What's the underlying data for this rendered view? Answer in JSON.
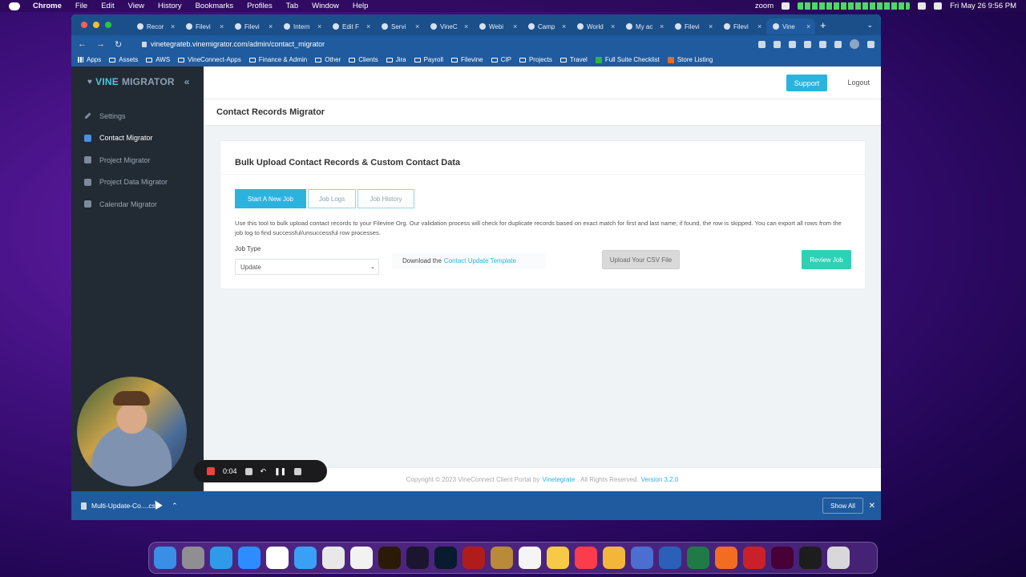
{
  "menubar": {
    "app": "Chrome",
    "items": [
      "File",
      "Edit",
      "View",
      "History",
      "Bookmarks",
      "Profiles",
      "Tab",
      "Window",
      "Help"
    ],
    "zoom": "zoom",
    "clock": "Fri May 26  9:56 PM"
  },
  "browser": {
    "tabs": [
      "Recor",
      "Filevi",
      "Filevi",
      "Intern",
      "Edit F",
      "Servi",
      "VineC",
      "Webi",
      "Camp",
      "World",
      "My ac",
      "Filevi",
      "Filevi",
      "Vine"
    ],
    "url": "vinetegrateb.vinemigrator.com/admin/contact_migrator",
    "bookmarks": [
      "Apps",
      "Assets",
      "AWS",
      "VineConnect-Apps",
      "Finance & Admin",
      "Other",
      "Clients",
      "Jira",
      "Payroll",
      "Filevine",
      "CIP",
      "Projects",
      "Travel",
      "Full Suite Checklist",
      "Store Listing"
    ]
  },
  "sidebar": {
    "logo_vine": "VINE",
    "logo_migrator": "MIGRATOR",
    "items": [
      {
        "label": "Settings"
      },
      {
        "label": "Contact Migrator"
      },
      {
        "label": "Project Migrator"
      },
      {
        "label": "Project Data Migrator"
      },
      {
        "label": "Calendar Migrator"
      }
    ]
  },
  "topbar": {
    "support": "Support",
    "logout": "Logout"
  },
  "page": {
    "title": "Contact Records Migrator",
    "card_title": "Bulk Upload Contact Records & Custom Contact Data",
    "tabs": [
      "Start A New Job",
      "Job Logs",
      "Job History"
    ],
    "description": "Use this tool to bulk upload contact records to your Filevine Org. Our validation process will check for duplicate records based on exact match for first and last name; if found, the row is skipped. You can export all rows from the job log to find successful/unsuccessful row processes.",
    "job_type_label": "Job Type",
    "job_type_value": "Update",
    "download_prefix": "Download the",
    "download_link": "Contact Update Template",
    "upload_button": "Upload Your CSV File",
    "review_button": "Review Job"
  },
  "footer": {
    "prefix": "Copyright © 2023 VineConnect Client Portal by",
    "company": "Vinetegrate",
    "suffix": ". All Rights Reserved.",
    "version": "Version 3.2.0"
  },
  "download_bar": {
    "file": "Multi-Update-Co....csv",
    "show_all": "Show All"
  },
  "recorder": {
    "time": "0:04"
  },
  "colors": {
    "accent": "#2bb3de",
    "review": "#2fd1b5",
    "sidebar": "#222a33",
    "chrome": "#1f5b9e"
  }
}
